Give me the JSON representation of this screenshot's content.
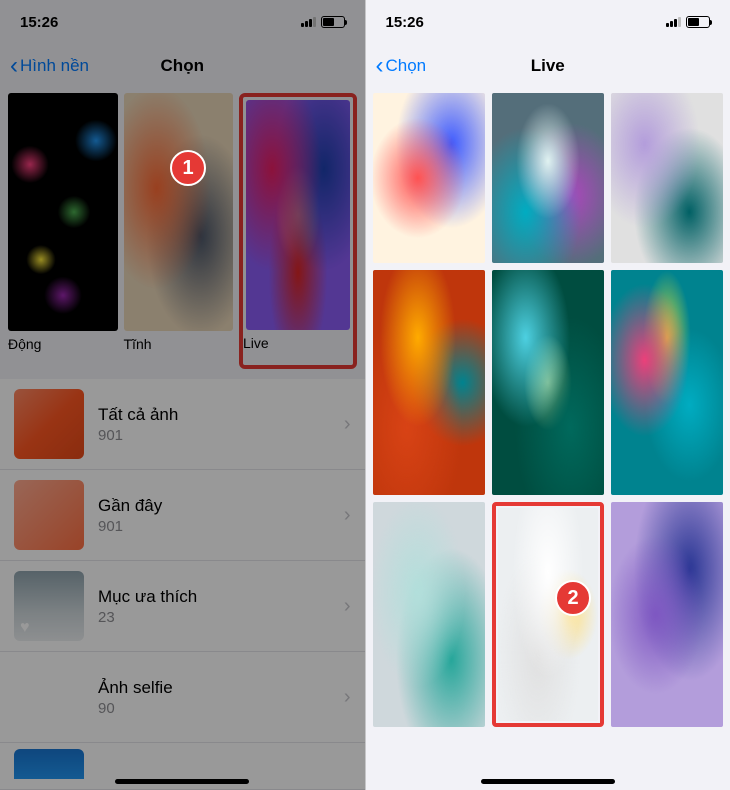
{
  "status": {
    "time": "15:26"
  },
  "left": {
    "back": "Hình nền",
    "title": "Chọn",
    "categories": [
      {
        "label": "Động"
      },
      {
        "label": "Tĩnh"
      },
      {
        "label": "Live"
      }
    ],
    "albums": [
      {
        "title": "Tất cả ảnh",
        "count": "901"
      },
      {
        "title": "Gần đây",
        "count": "901"
      },
      {
        "title": "Mục ưa thích",
        "count": "23"
      },
      {
        "title": "Ảnh selfie",
        "count": "90"
      }
    ]
  },
  "right": {
    "back": "Chọn",
    "title": "Live"
  },
  "badges": {
    "one": "1",
    "two": "2"
  }
}
